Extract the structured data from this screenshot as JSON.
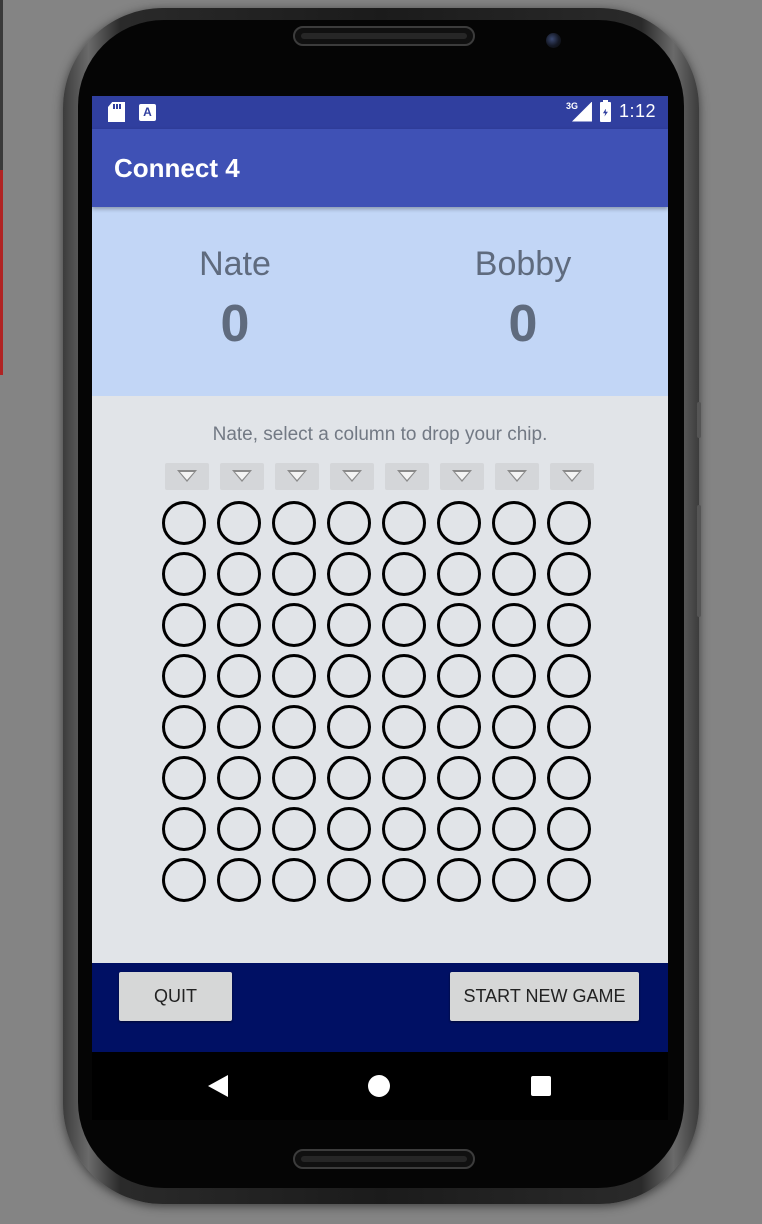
{
  "status_bar": {
    "network": "3G",
    "time": "1:12",
    "icons": [
      "sd-card-icon",
      "keyboard-a-icon",
      "signal-icon",
      "battery-charging-icon"
    ]
  },
  "app": {
    "title": "Connect 4"
  },
  "players": [
    {
      "name": "Nate",
      "score": "0"
    },
    {
      "name": "Bobby",
      "score": "0"
    }
  ],
  "board": {
    "prompt": "Nate, select a column to drop your chip.",
    "columns": 8,
    "rows": 8
  },
  "buttons": {
    "quit": "QUIT",
    "new_game": "START NEW GAME"
  },
  "nav": {
    "icons": [
      "back-icon",
      "home-icon",
      "recents-icon"
    ]
  },
  "colors": {
    "status_bar": "#303f9f",
    "app_bar": "#3f51b5",
    "score_panel": "#c2d6f6",
    "board_background": "#e1e4e8",
    "bottom_bar": "#001064"
  }
}
